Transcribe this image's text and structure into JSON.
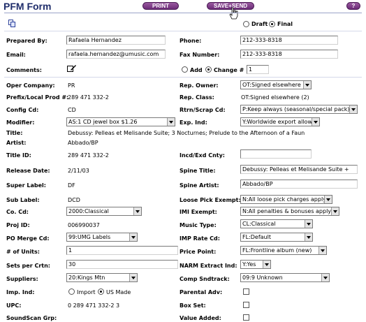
{
  "header": {
    "title": "PFM Form",
    "print_label": "PRINT",
    "save_send_label": "SAVE+SEND",
    "help_label": "?"
  },
  "status": {
    "draft_label": "Draft",
    "final_label": "Final",
    "selected": "Final"
  },
  "contact": {
    "prepared_by_label": "Prepared By:",
    "prepared_by": "Rafaela Hernandez",
    "phone_label": "Phone:",
    "phone": "212-333-8318",
    "email_label": "Email:",
    "email": "rafaela.hernandez@umusic.com",
    "fax_label": "Fax Number:",
    "fax": "212-333-8318",
    "comments_label": "Comments:",
    "add_label": "Add",
    "change_label": "Change #",
    "change_value": "1",
    "change_selected": "Change #"
  },
  "details": {
    "oper_company_label": "Oper Company:",
    "oper_company": "PR",
    "rep_owner_label": "Rep. Owner:",
    "rep_owner": "OT:Signed elsewhere",
    "prefix_label": "Prefix/Local Prod #:",
    "prefix": "289 471 332-2",
    "rep_class_label": "Rep. Class:",
    "rep_class": "OT:Signed elsewhere (2)",
    "config_label": "Config Cd:",
    "config": "CD",
    "rtrn_label": "Rtrn/Scrap Cd:",
    "rtrn": "P:Keep always (seasonal/special pack)",
    "modifier_label": "Modifier:",
    "modifier": "AS:1 CD jewel box $1.26",
    "exp_ind_label": "Exp. Ind:",
    "exp_ind": "Y:Worldwide export allowed",
    "title_label": "Title:",
    "title": "Debussy: Pelleas et Melisande Suite; 3 Nocturnes; Prelude to the Afternoon of a Faun",
    "artist_label": "Artist:",
    "artist": "Abbado/BP",
    "title_id_label": "Title ID:",
    "title_id": "289 471 332-2",
    "incd_label": "Incd/Exd Cnty:",
    "incd": "",
    "release_label": "Release Date:",
    "release": "2/11/03",
    "spine_title_label": "Spine Title:",
    "spine_title": "Debussy: Pelleas et Melisande Suite +",
    "super_label_label": "Super Label:",
    "super_label": "DF",
    "spine_artist_label": "Spine Artist:",
    "spine_artist": "Abbado/BP",
    "sub_label_label": "Sub Label:",
    "sub_label": "DCD",
    "loose_pick_label": "Loose Pick Exempt:",
    "loose_pick": "N:All loose pick charges apply",
    "co_cd_label": "Co. Cd:",
    "co_cd": "2000:Classical",
    "imi_label": "IMI Exempt:",
    "imi": "N:All penalties & bonuses apply",
    "proj_id_label": "Proj ID:",
    "proj_id": "006990037",
    "music_type_label": "Music Type:",
    "music_type": "CL:Classical",
    "po_merge_label": "PO Merge Cd:",
    "po_merge": "99:UMG Labels",
    "imp_rate_label": "IMP Rate Cd:",
    "imp_rate": "FL:Default",
    "units_label": "# of Units:",
    "units": "1",
    "price_point_label": "Price Point:",
    "price_point": "FL:Frontline album (new)",
    "sets_label": "Sets per Crtn:",
    "sets": "30",
    "narm_label": "NARM Extract Ind:",
    "narm": "Y:Yes",
    "suppliers_label": "Suppliers:",
    "suppliers": "20:Kings Mtn",
    "comp_label": "Comp Sndtrack:",
    "comp": "09:9 Unknown",
    "imp_ind_label": "Imp. Ind:",
    "import_label": "Import",
    "us_made_label": "US Made",
    "imp_selected": "US Made",
    "parental_label": "Parental Adv:",
    "upc_label": "UPC:",
    "upc": "0 289 471 332-2 3",
    "box_set_label": "Box Set:",
    "soundscan_label": "SoundScan Grp:",
    "value_added_label": "Value Added:"
  },
  "colors": {
    "title": "#1f2d6b",
    "button": "#6c2d78",
    "rule": "#9aa3c8"
  }
}
